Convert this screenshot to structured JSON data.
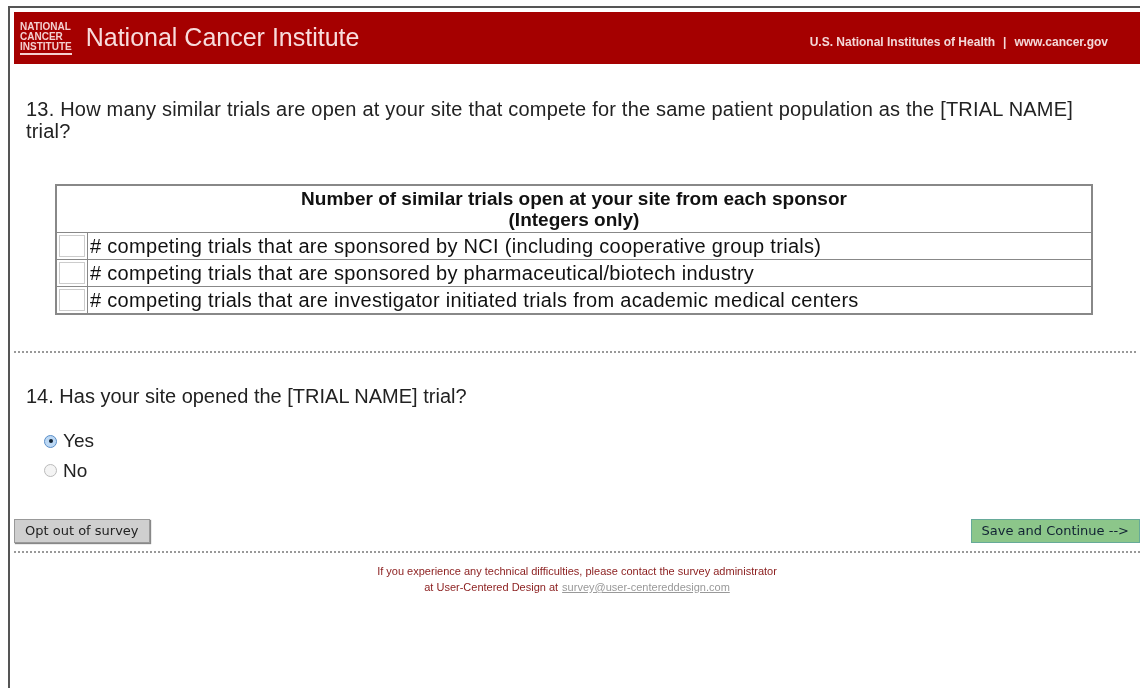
{
  "header": {
    "logo_lines": [
      "NATIONAL",
      "CANCER",
      "INSTITUTE"
    ],
    "title": "National Cancer Institute",
    "nih_link": "U.S. National Institutes of Health",
    "separator": "|",
    "site_link": "www.cancer.gov"
  },
  "question_13": {
    "text": "13. How many similar trials are open at your site that compete for the same patient population as the [TRIAL NAME] trial?",
    "table": {
      "heading": "Number of similar trials open at your site from each sponsor",
      "subheading": "(Integers only)",
      "rows": [
        {
          "label": "# competing trials that are sponsored by NCI (including cooperative group trials)"
        },
        {
          "label": "# competing trials that are sponsored by pharmaceutical/biotech industry"
        },
        {
          "label": "# competing trials that are investigator initiated trials from academic medical centers"
        }
      ]
    }
  },
  "question_14": {
    "text": "14. Has your site opened the [TRIAL NAME] trial?",
    "options": [
      {
        "label": "Yes",
        "selected": true
      },
      {
        "label": "No",
        "selected": false
      }
    ]
  },
  "buttons": {
    "opt_out": "Opt out of survey",
    "save": "Save and Continue -->"
  },
  "footer": {
    "line_1": "If you experience any technical difficulties, please contact the survey administrator",
    "line_2": "at User-Centered Design at",
    "email": "survey@user-centereddesign.com"
  }
}
